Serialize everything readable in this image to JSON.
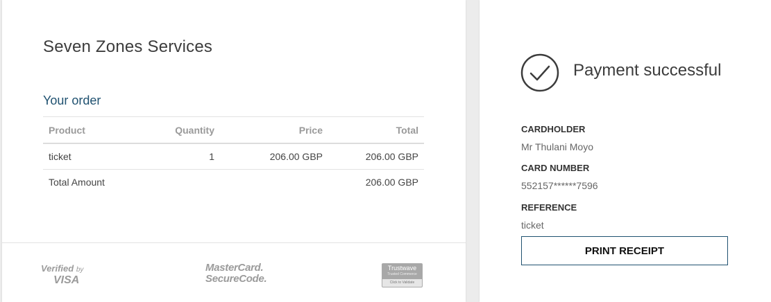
{
  "merchant": {
    "name": "Seven Zones Services"
  },
  "order": {
    "title": "Your order",
    "columns": [
      "Product",
      "Quantity",
      "Price",
      "Total"
    ],
    "rows": [
      {
        "product": "ticket",
        "quantity": "1",
        "price": "206.00 GBP",
        "total": "206.00 GBP"
      }
    ],
    "total_label": "Total Amount",
    "total_value": "206.00 GBP"
  },
  "footer": {
    "visa_line1": "Verified",
    "visa_by": "by",
    "visa_line2": "VISA",
    "mastercard_line1": "MasterCard.",
    "mastercard_line2": "SecureCode.",
    "trustwave_line1": "Trustwave",
    "trustwave_line2": "Trusted Commerce",
    "trustwave_line3": "Click to Validate"
  },
  "payment": {
    "status_title": "Payment successful",
    "status_icon": "check-circle-icon",
    "cardholder_label": "CARDHOLDER",
    "cardholder_value": "Mr Thulani Moyo",
    "card_number_label": "CARD NUMBER",
    "card_number_value": "552157******7596",
    "reference_label": "REFERENCE",
    "reference_value": "ticket",
    "print_label": "PRINT RECEIPT"
  },
  "colors": {
    "accent": "#1f5170",
    "header_text": "#9a9a9a",
    "background": "#ececec"
  }
}
